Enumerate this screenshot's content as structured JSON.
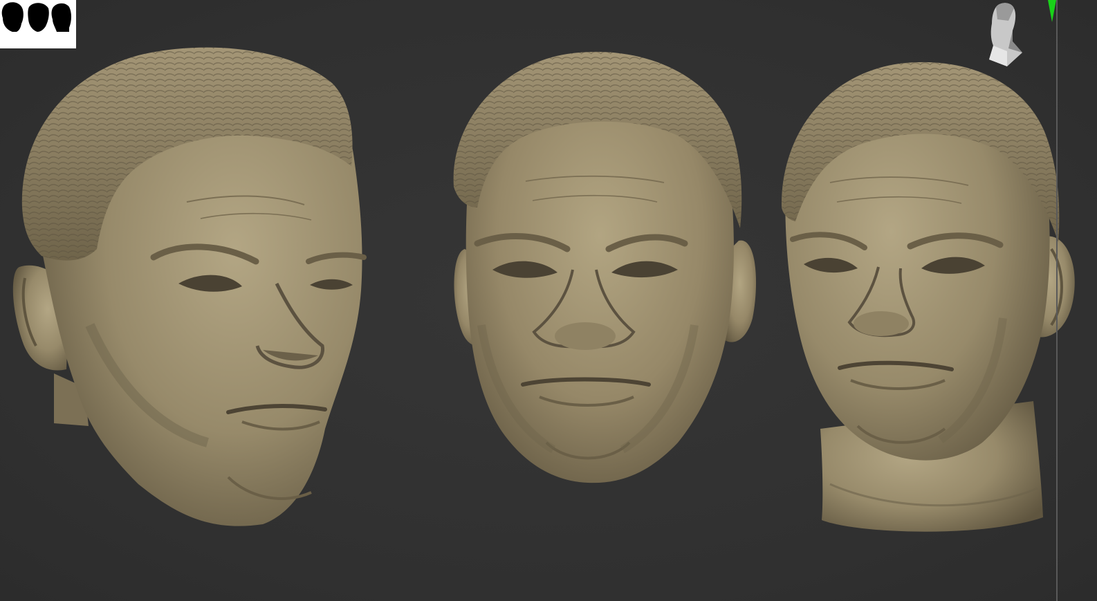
{
  "app": {
    "type": "3d-sculpt-viewport"
  },
  "viewport": {
    "background": "#323232",
    "material_color": "#9b8d6d"
  },
  "thumbnail": {
    "icon": "head-silhouettes-thumbnail",
    "background": "#ffffff",
    "silhouette_color": "#000000"
  },
  "models": [
    {
      "view": "three-quarter-left",
      "icon": "head-sculpt"
    },
    {
      "view": "front",
      "icon": "head-sculpt"
    },
    {
      "view": "three-quarter-right-with-neck",
      "icon": "head-sculpt"
    }
  ],
  "navigation": {
    "icon": "orientation-head-gizmo",
    "axis_marker_color": "#19d219"
  }
}
